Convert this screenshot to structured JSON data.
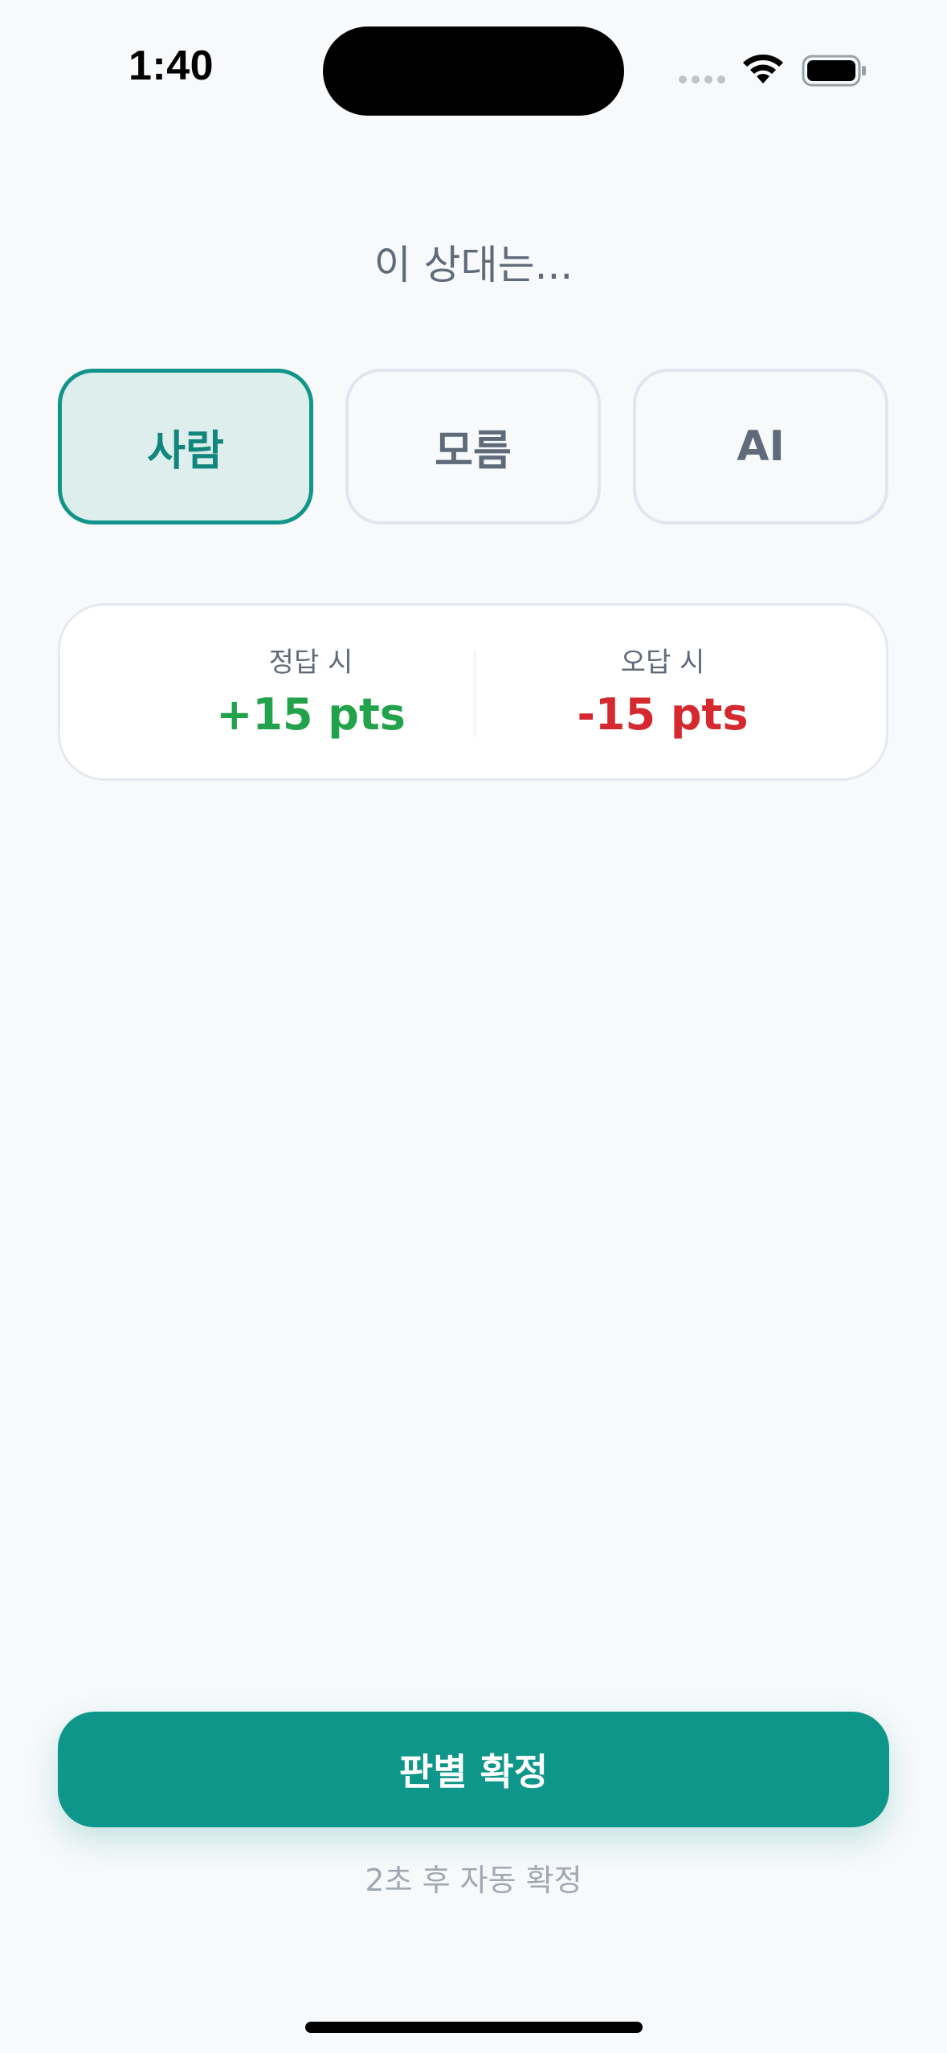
{
  "status_bar": {
    "time": "1:40",
    "signal_icon": "signal-dots-icon",
    "wifi_icon": "wifi-icon",
    "battery_icon": "battery-icon"
  },
  "prompt": "이 상대는...",
  "options": [
    {
      "label": "사람",
      "selected": true
    },
    {
      "label": "모름",
      "selected": false
    },
    {
      "label": "AI",
      "selected": false
    }
  ],
  "score": {
    "correct_label": "정답 시",
    "correct_value": "+15 pts",
    "wrong_label": "오답 시",
    "wrong_value": "-15 pts"
  },
  "confirm_button": "판별 확정",
  "auto_confirm_text": "2초 후 자동 확정",
  "colors": {
    "accent": "#0e968a",
    "selected_bg": "#ddeeec",
    "positive": "#22a24a",
    "negative": "#d4292e",
    "background": "#f7f9fb"
  }
}
